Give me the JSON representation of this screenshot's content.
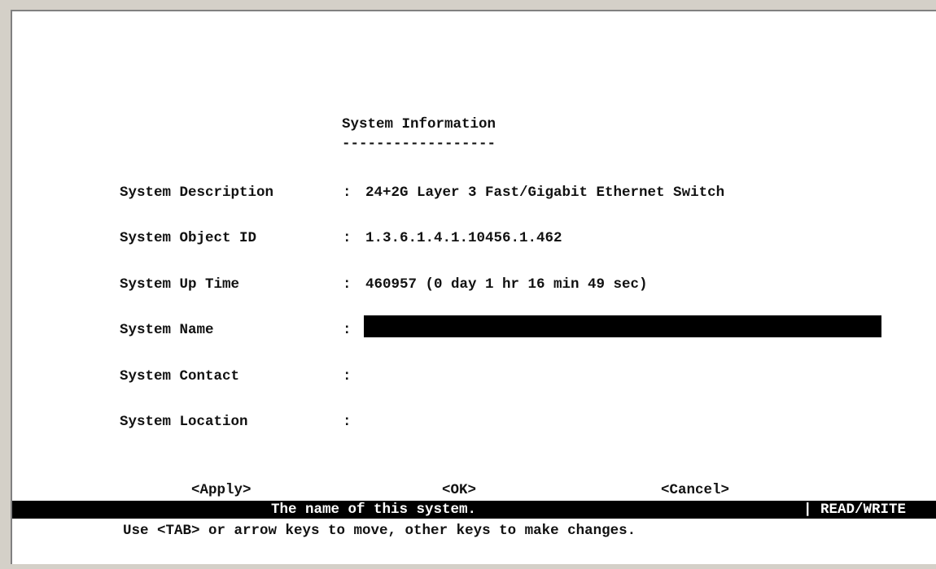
{
  "screen": {
    "title": "System Information",
    "title_underline": "------------------"
  },
  "fields": [
    {
      "label": "System Description",
      "value": "24+2G Layer 3 Fast/Gigabit Ethernet Switch"
    },
    {
      "label": "System Object ID",
      "value": "1.3.6.1.4.1.10456.1.462"
    },
    {
      "label": "System Up Time",
      "value": "460957 (0 day 1 hr 16 min 49 sec)"
    },
    {
      "label": "System Name",
      "value": ""
    },
    {
      "label": "System Contact",
      "value": ""
    },
    {
      "label": "System Location",
      "value": ""
    }
  ],
  "separator": ":",
  "buttons": {
    "apply": "<Apply>",
    "ok": "<OK>",
    "cancel": "<Cancel>"
  },
  "status": {
    "message": "The name of this system.",
    "access": "| READ/WRITE"
  },
  "help": "Use <TAB> or arrow keys to move, other keys to make changes.",
  "colors": {
    "background": "#ffffff",
    "text": "#111111",
    "status_bar": "#000000",
    "selected_field": "#000000"
  }
}
